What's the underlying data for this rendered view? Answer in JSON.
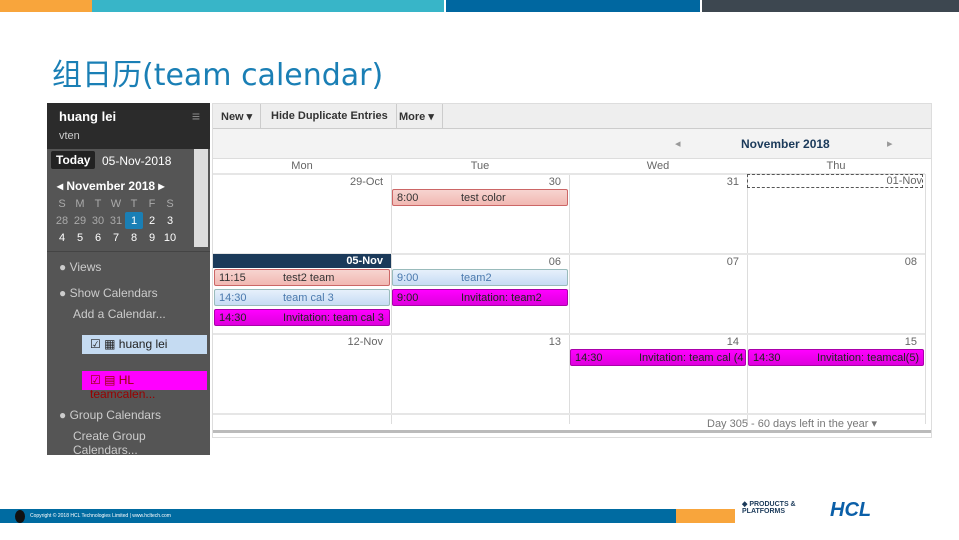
{
  "slide": {
    "title": "组日历(team calendar)",
    "footer": "Copyright © 2018 HCL Technologies Limited | www.hcltech.com",
    "logo_products": "PRODUCTS & PLATFORMS",
    "logo_hcl": "HCL",
    "colors": {
      "orange": "#f8a53c",
      "teal": "#38b5c8",
      "blue": "#0067a0",
      "dark": "#3d4750"
    }
  },
  "sidebar": {
    "user": "huang lei",
    "subtitle": "vten",
    "today_label": "Today",
    "today_date": "05-Nov-2018",
    "month": "November",
    "year": "2018",
    "weekdays": [
      "S",
      "M",
      "T",
      "W",
      "T",
      "F",
      "S"
    ],
    "weeks": [
      [
        "28",
        "29",
        "30",
        "31",
        "1",
        "2",
        "3"
      ],
      [
        "4",
        "5",
        "6",
        "7",
        "8",
        "9",
        "10"
      ]
    ],
    "views": "Views",
    "show_calendars": "Show Calendars",
    "add_calendar": "Add a Calendar...",
    "calendars": [
      {
        "name": "huang lei",
        "checked": true,
        "color": "#c5dbf2"
      },
      {
        "name": "HL teamcalen...",
        "checked": true,
        "color": "#ff00ff"
      }
    ],
    "group_calendars": "Group Calendars",
    "create_group": "Create Group Calendars..."
  },
  "toolbar": {
    "new": "New ▾",
    "hide_dup": "Hide Duplicate Entries",
    "more": "More ▾"
  },
  "calendar": {
    "month_title": "November 2018",
    "days": [
      "Mon",
      "Tue",
      "Wed",
      "Thu"
    ],
    "weeks": [
      {
        "dates": [
          "29-Oct",
          "30",
          "31",
          "01-Nov"
        ]
      },
      {
        "dates": [
          "05-Nov",
          "06",
          "07",
          "08"
        ]
      },
      {
        "dates": [
          "12-Nov",
          "13",
          "14",
          "15"
        ]
      }
    ],
    "events": [
      {
        "time": "8:00",
        "name": "test color"
      },
      {
        "time": "11:15",
        "name": "test2 team"
      },
      {
        "time": "14:30",
        "name": "team cal 3"
      },
      {
        "time": "14:30",
        "name": "Invitation: team cal 3"
      },
      {
        "time": "9:00",
        "name": "team2"
      },
      {
        "time": "9:00",
        "name": "Invitation: team2"
      },
      {
        "time": "14:30",
        "name": "Invitation: team cal (4"
      },
      {
        "time": "14:30",
        "name": "Invitation: teamcal(5)"
      }
    ],
    "status": "Day 305 - 60 days left in the year ▾"
  }
}
